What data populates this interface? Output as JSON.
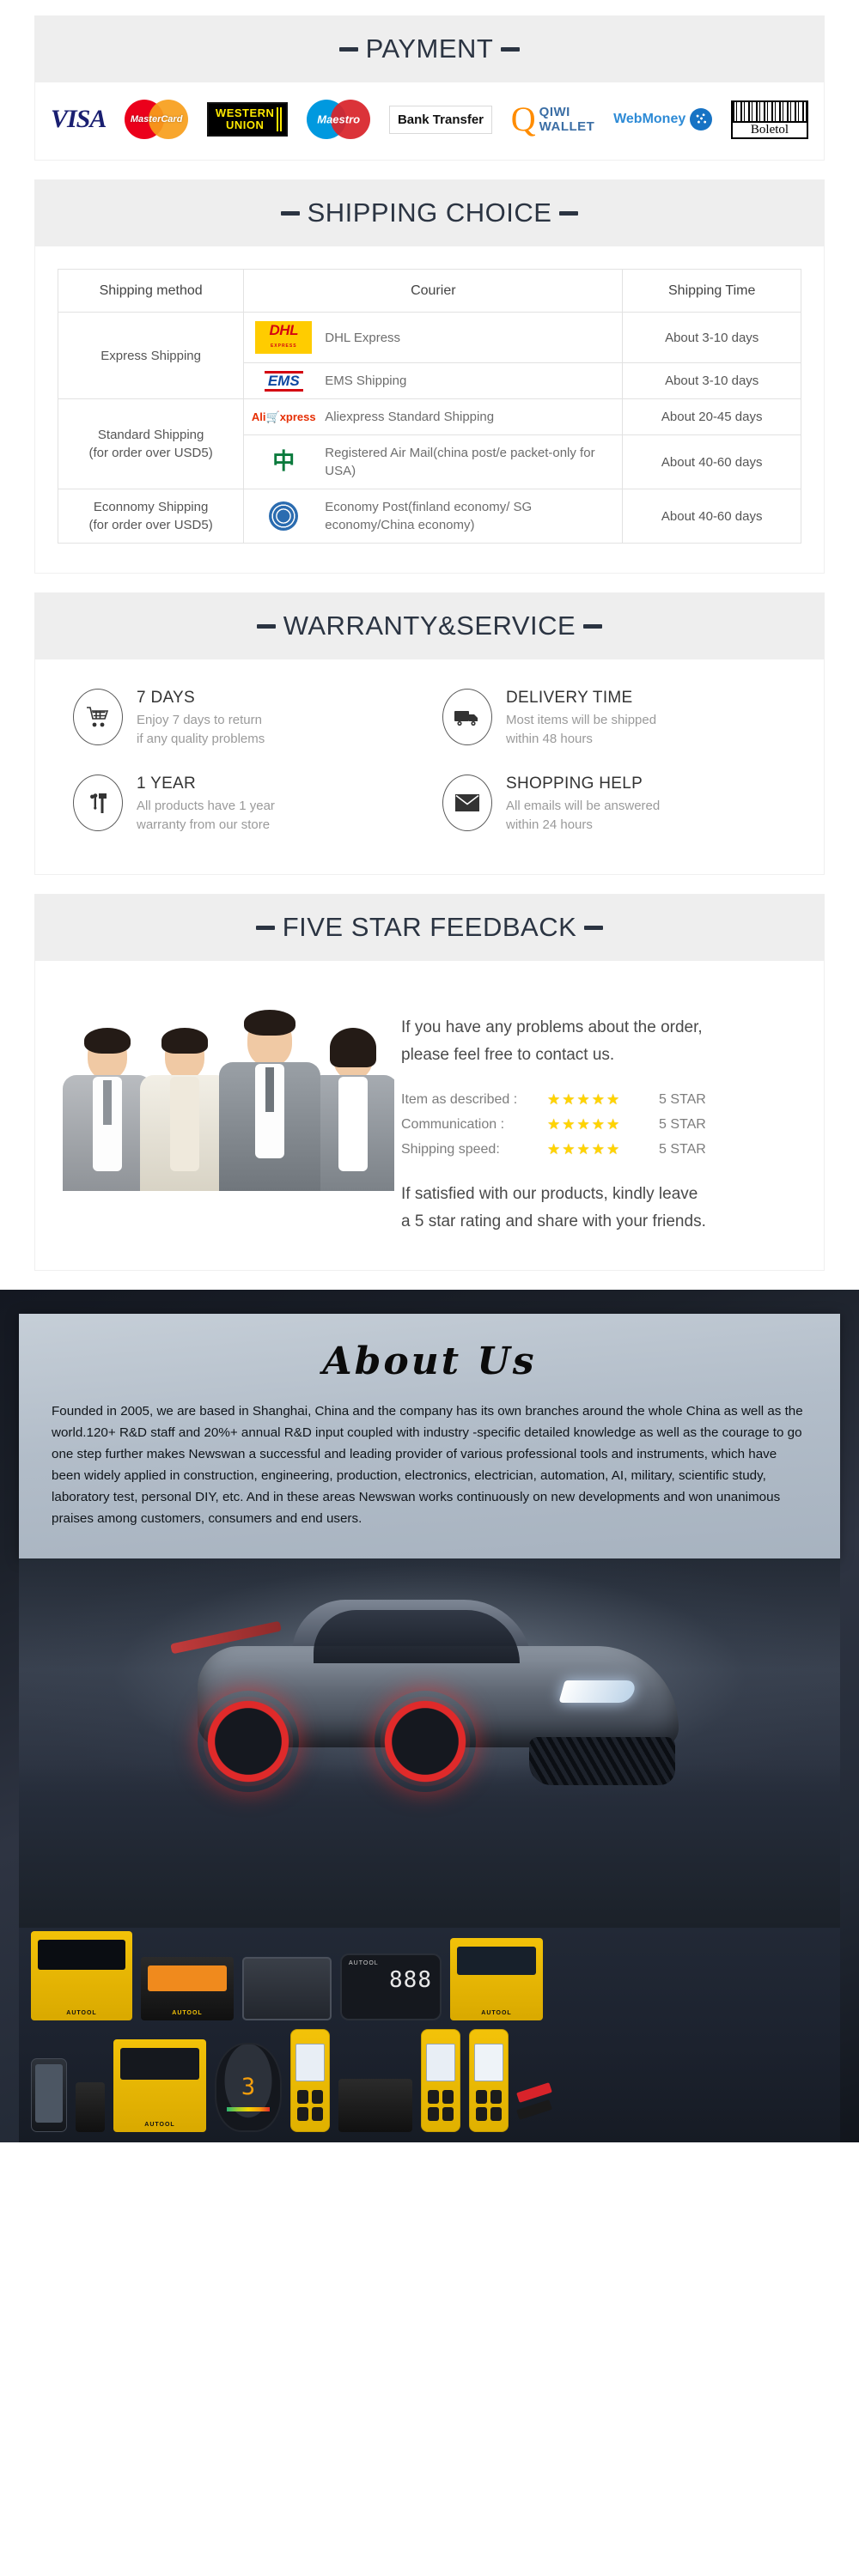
{
  "payment": {
    "title": "PAYMENT",
    "methods": [
      {
        "name": "Visa",
        "label": "VISA"
      },
      {
        "name": "MasterCard",
        "label": "MasterCard"
      },
      {
        "name": "Western Union",
        "label": "WESTERN",
        "label2": "UNION"
      },
      {
        "name": "Maestro",
        "label": "Maestro"
      },
      {
        "name": "Bank Transfer",
        "label": "Bank Transfer"
      },
      {
        "name": "QIWI Wallet",
        "label": "QIWI",
        "label2": "WALLET"
      },
      {
        "name": "WebMoney",
        "label": "WebMoney"
      },
      {
        "name": "Boleto",
        "label": "Boletol"
      }
    ]
  },
  "shipping": {
    "title": "SHIPPING CHOICE",
    "headers": [
      "Shipping method",
      "Courier",
      "Shipping Time"
    ],
    "groups": [
      {
        "method": "Express Shipping",
        "method_note": "",
        "rows": [
          {
            "logo": "dhl",
            "courier": "DHL Express",
            "time": "About 3-10 days"
          },
          {
            "logo": "ems",
            "courier": "EMS Shipping",
            "time": "About 3-10 days"
          }
        ]
      },
      {
        "method": "Standard Shipping",
        "method_note": "(for order over USD5)",
        "rows": [
          {
            "logo": "aliexpress",
            "courier": "Aliexpress Standard Shipping",
            "time": "About 20-45 days"
          },
          {
            "logo": "chinapost",
            "courier": "Registered Air Mail(china post/e packet-only for USA)",
            "time": "About 40-60 days"
          }
        ]
      },
      {
        "method": "Econnomy Shipping",
        "method_note": "(for order over USD5)",
        "rows": [
          {
            "logo": "un",
            "courier": "Economy Post(finland economy/ SG economy/China economy)",
            "time": "About 40-60 days"
          }
        ]
      }
    ]
  },
  "warranty": {
    "title": "WARRANTY&SERVICE",
    "items": [
      {
        "icon": "shopping-cart-icon",
        "heading": "7 DAYS",
        "line1": "Enjoy 7 days to return",
        "line2": "if any quality problems"
      },
      {
        "icon": "delivery-truck-icon",
        "heading": "DELIVERY TIME",
        "line1": "Most items will be shipped",
        "line2": "within 48 hours"
      },
      {
        "icon": "tools-icon",
        "heading": "1 YEAR",
        "line1": "All products have 1 year",
        "line2": "warranty from our store"
      },
      {
        "icon": "envelope-icon",
        "heading": "SHOPPING HELP",
        "line1": "All emails will be answered",
        "line2": "within 24 hours"
      }
    ]
  },
  "feedback": {
    "title": "FIVE STAR FEEDBACK",
    "lead_line1": "If you have any problems about the order,",
    "lead_line2": "please feel free to contact us.",
    "ratings": [
      {
        "label": "Item as described :",
        "stars": "★★★★★",
        "value": "5 STAR"
      },
      {
        "label": "Communication :",
        "stars": "★★★★★",
        "value": "5 STAR"
      },
      {
        "label": "Shipping speed:",
        "stars": "★★★★★",
        "value": "5 STAR"
      }
    ],
    "footer_line1": "If satisfied with our products, kindly leave",
    "footer_line2": "a 5 star rating and share with your friends."
  },
  "about": {
    "title": "About  Us",
    "body": "Founded in 2005, we are based in Shanghai, China and the company has its own branches around the whole China as well as the world.120+ R&D staff and 20%+ annual R&D input coupled with industry -specific detailed knowledge as well as the courage to go one step further makes Newswan a successful and leading provider of various professional tools and instruments, which have been widely applied in construction, engineering, production, electronics, electrician, automation, AI, military, scientific study, laboratory test, personal DIY, etc. And in these areas Newswan works continuously on new developments and won unanimous praises among customers, consumers and end users.",
    "hero_alt": "sports-car-with-glowing-red-wheels",
    "brand": "AUTOOL",
    "hud_digits": "888",
    "gauge_value": "3"
  },
  "colors": {
    "title_navy": "#2b3442",
    "header_grey": "#eeeeee",
    "muted_text": "#9a9a9a",
    "star_yellow": "#ffd400"
  }
}
